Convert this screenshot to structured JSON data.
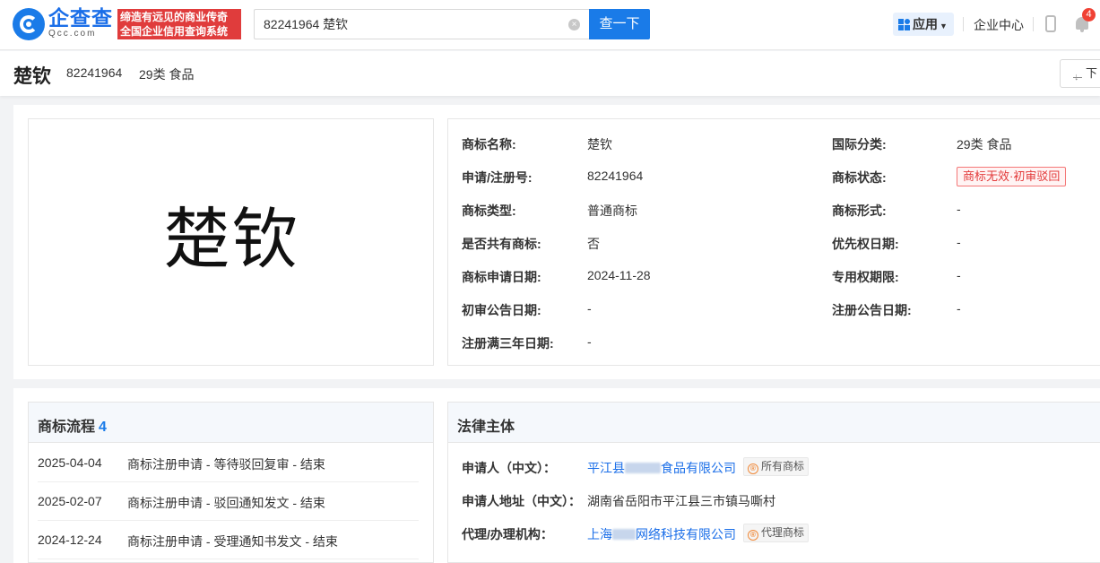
{
  "header": {
    "brand_name": "企查查",
    "brand_sub": "Qcc.com",
    "slogan_line1": "缔造有远见的商业传奇",
    "slogan_line2": "全国企业信用查询系统",
    "search_value": "82241964 楚钦",
    "search_button": "查一下",
    "apps_label": "应用",
    "enterprise_center": "企业中心",
    "notification_count": "4",
    "accent_color": "#1a7be8"
  },
  "title_bar": {
    "name": "楚钦",
    "reg_no": "82241964",
    "class": "29类 食品",
    "download_label": "下"
  },
  "trademark": {
    "image_text": "楚钦",
    "fields_left": [
      {
        "label": "商标名称:",
        "value": "楚钦"
      },
      {
        "label": "申请/注册号:",
        "value": "82241964"
      },
      {
        "label": "商标类型:",
        "value": "普通商标"
      },
      {
        "label": "是否共有商标:",
        "value": "否"
      },
      {
        "label": "商标申请日期:",
        "value": "2024-11-28"
      },
      {
        "label": "初审公告日期:",
        "value": "-"
      },
      {
        "label": "注册满三年日期:",
        "value": "-"
      }
    ],
    "fields_right": [
      {
        "label": "国际分类:",
        "value": "29类 食品"
      },
      {
        "label": "商标状态:",
        "value": "商标无效·初审驳回"
      },
      {
        "label": "商标形式:",
        "value": "-"
      },
      {
        "label": "优先权日期:",
        "value": "-"
      },
      {
        "label": "专用权期限:",
        "value": "-"
      },
      {
        "label": "注册公告日期:",
        "value": "-"
      }
    ],
    "status_color": "#e33a3a"
  },
  "flow": {
    "title": "商标流程",
    "count": "4",
    "items": [
      {
        "date": "2025-04-04",
        "desc": "商标注册申请 - 等待驳回复审 - 结束"
      },
      {
        "date": "2025-02-07",
        "desc": "商标注册申请 - 驳回通知发文 - 结束"
      },
      {
        "date": "2024-12-24",
        "desc": "商标注册申请 - 受理通知书发文 - 结束"
      }
    ]
  },
  "legal": {
    "title": "法律主体",
    "applicant_label": "申请人（中文）：",
    "applicant_prefix": "平江县",
    "applicant_suffix": "食品有限公司",
    "applicant_tag": "所有商标",
    "address_label": "申请人地址（中文）：",
    "address_value": "湖南省岳阳市平江县三市镇马嘶村",
    "agent_label": "代理/办理机构：",
    "agent_prefix": "上海",
    "agent_suffix": "网络科技有限公司",
    "agent_tag": "代理商标"
  }
}
